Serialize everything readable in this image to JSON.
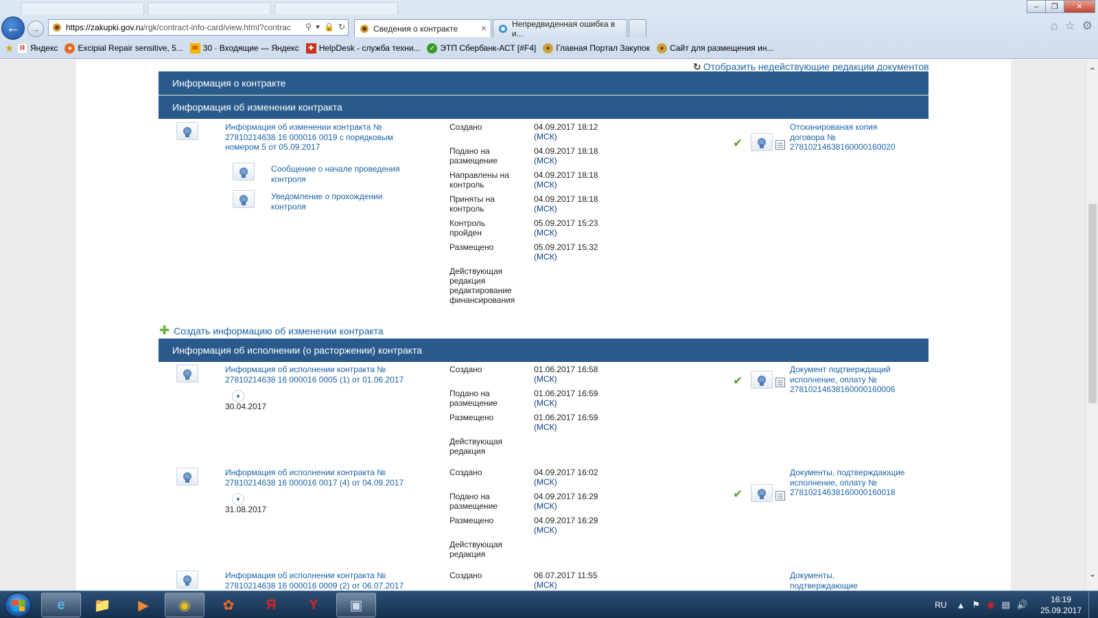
{
  "browser": {
    "address_url": "https://zakupki.gov.ru/rgk/contract-info-card/view.html?contrac",
    "address_url_host": "https://zakupki.gov.ru",
    "address_url_rest": "/rgk/contract-info-card/view.html?contrac",
    "tabs": [
      {
        "label": "Сведения о контракте",
        "active": true
      },
      {
        "label": "Непредвиденная ошибка в и...",
        "active": false
      }
    ],
    "favorites": [
      {
        "label": "Яндекс",
        "icon": "yandex-icon"
      },
      {
        "label": "Excipial Repair sensitive, 5...",
        "icon": "excipial-icon"
      },
      {
        "label": "30 · Входящие — Яндекс",
        "icon": "mail-icon"
      },
      {
        "label": "HelpDesk - служба техни...",
        "icon": "helpdesk-icon"
      },
      {
        "label": "ЭТП Сбербанк-АСТ [#F4]",
        "icon": "sberbank-icon"
      },
      {
        "label": "Главная Портал Закупок",
        "icon": "emblem-icon"
      },
      {
        "label": "Сайт для размещения ин...",
        "icon": "emblem-icon"
      }
    ]
  },
  "page": {
    "show_old_versions": "Отобразить недействующие редакции документов",
    "section_contract_info": "Информация о контракте",
    "section_changes": "Информация об изменении контракта",
    "section_execution": "Информация об исполнении (о расторжении) контракта",
    "create_change_link": "Создать информацию об изменении контракта",
    "tz": "(МСК)",
    "change_record": {
      "title": "Информация об изменении контракта № 27810214638 16 000016 0019 с порядковым номером 5 от 05.09.2017",
      "sublinks": [
        "Сообщение о начале проведения контроля",
        "Уведомление о прохождении контроля"
      ],
      "statuses": [
        {
          "label": "Создано",
          "date": "04.09.2017 18:12"
        },
        {
          "label": "Подано на размещение",
          "date": "04.09.2017 18:18"
        },
        {
          "label": "Направлены на контроль",
          "date": "04.09.2017 18:18"
        },
        {
          "label": "Приняты на контроль",
          "date": "04.09.2017 18:18"
        },
        {
          "label": "Контроль пройден",
          "date": "05.09.2017 15:23"
        },
        {
          "label": "Размещено",
          "date": "05.09.2017 15:32"
        },
        {
          "label": "Действующая редакция редактирование финансирования",
          "date": ""
        }
      ],
      "attachment": "Отсканированая копия договора № 2781021463816000016002​0"
    },
    "execution_records": [
      {
        "title": "Информация об исполнении контракта № 27810214638 16 000016 0005 (1) от 01.06.2017",
        "sub_date": "30.04.2017",
        "statuses": [
          {
            "label": "Создано",
            "date": "01.06.2017 16:58"
          },
          {
            "label": "Подано на размещение",
            "date": "01.06.2017 16:59"
          },
          {
            "label": "Размещено",
            "date": "01.06.2017 16:59"
          },
          {
            "label": "Действующая редакция",
            "date": ""
          }
        ],
        "attachment": "Документ подтверждащий исполнение, оплату № 27810214638160000160006"
      },
      {
        "title": "Информация об исполнении контракта № 27810214638 16 000016 0017 (4) от 04.09.2017",
        "sub_date": "31.08.2017",
        "statuses": [
          {
            "label": "Создано",
            "date": "04.09.2017 16:02"
          },
          {
            "label": "Подано на размещение",
            "date": "04.09.2017 16:29"
          },
          {
            "label": "Размещено",
            "date": "04.09.2017 16:29"
          },
          {
            "label": "Действующая редакция",
            "date": ""
          }
        ],
        "attachment": "Документы, подтверждающие исполнение, оплату № 27810214638160000160018"
      },
      {
        "title": "Информация об исполнении контракта № 27810214638 16 000016 0009 (2) от 06.07.2017",
        "statuses": [
          {
            "label": "Создано",
            "date": "06.07.2017 11:55"
          }
        ],
        "attachment": "Документы, подтверждающие"
      }
    ]
  },
  "taskbar": {
    "lang": "RU",
    "time": "16:19",
    "date": "25.09.2017",
    "apps": [
      "internet-explorer",
      "file-explorer",
      "media-player",
      "chrome",
      "app-orange",
      "yandex",
      "yandex-browser",
      "remote-desktop"
    ]
  },
  "colors": {
    "section_header": "#2a5a8c",
    "link": "#1a62a5",
    "tz": "#0a3d8a"
  }
}
